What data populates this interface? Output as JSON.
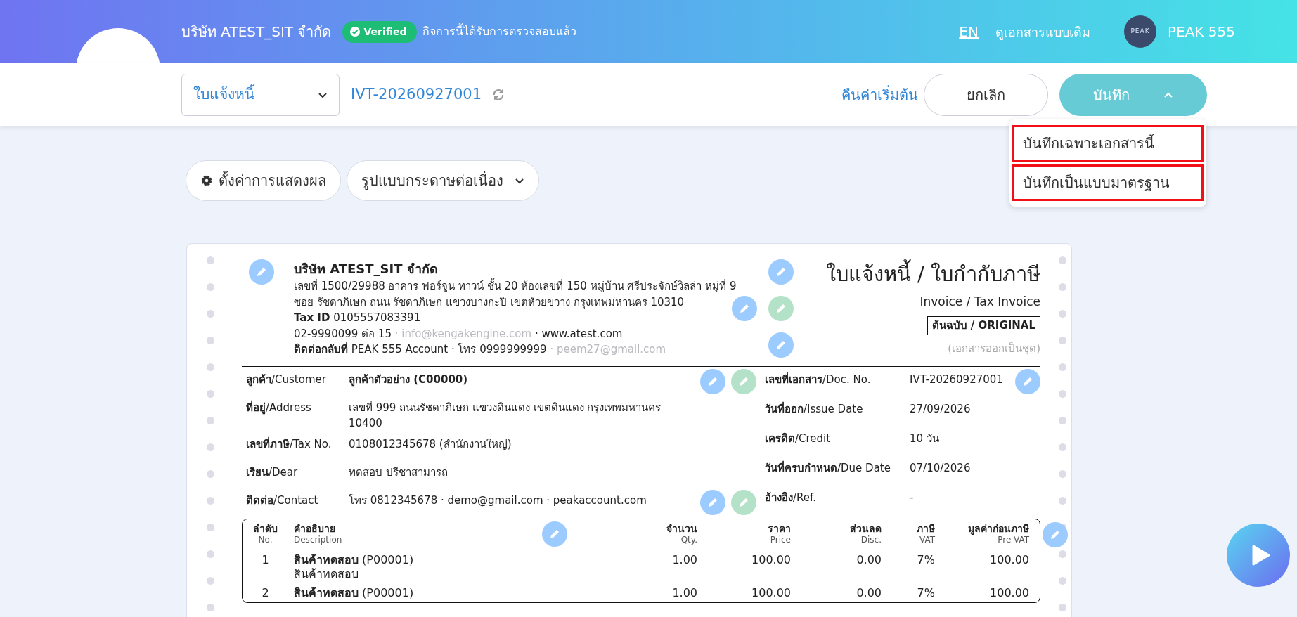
{
  "header": {
    "company": "บริษัท ATEST_SIT จำกัด",
    "verified_badge": "Verified",
    "verified_text": "กิจการนี้ได้รับการตรวจสอบแล้ว",
    "language": "EN",
    "old_view_link": "ดูเอกสารแบบเดิม",
    "user_logo_text": "PEAK",
    "user_name": "PEAK 555"
  },
  "toolbar": {
    "doc_type": "ใบแจ้งหนี้",
    "doc_number": "IVT-20260927001",
    "reset_link": "คืนค่าเริ่มต้น",
    "cancel_button": "ยกเลิก",
    "save_button": "บันทึก",
    "save_menu_expanded": true,
    "save_menu": [
      {
        "label": "บันทึกเฉพาะเอกสารนี้",
        "highlighted": true
      },
      {
        "label": "บันทึกเป็นแบบมาตรฐาน",
        "highlighted": true
      }
    ]
  },
  "display_controls": {
    "settings_button": "ตั้งค่าการแสดงผล",
    "paper_format": "รูปแบบกระดาษต่อเนื่อง"
  },
  "document": {
    "seller": {
      "name": "บริษัท ATEST_SIT จำกัด",
      "address_lines": [
        "เลขที่ 1500/29988 อาคาร ฟอร์จูน ทาวน์ ชั้น 20 ห้องเลขที่ 150 หมู่บ้าน ศรีประจักษ์วิลล่า หมู่ที่ 9",
        "ซอย รัชดาภิเษก ถนน รัชดาภิเษก แขวงบางกะปิ เขตห้วยขวาง กรุงเทพมหานคร 10310"
      ],
      "tax_id_label": "Tax ID",
      "tax_id": "0105557083391",
      "phone": "02-9990099 ต่อ 15",
      "email": "· info@kengakengine.com",
      "website": "· www.atest.com",
      "contact_label": "ติดต่อกลับที่",
      "contact": "PEAK 555 Account · โทร 0999999999",
      "contact_email": "· peem27@gmail.com"
    },
    "title": "ใบแจ้งหนี้ / ใบกำกับภาษี",
    "subtitle": "Invoice / Tax Invoice",
    "copy_label": "ต้นฉบับ / ORIGINAL",
    "set_note": "(เอกสารออกเป็นชุด)",
    "customer_fields": [
      {
        "label_th": "ลูกค้า",
        "label_en": "/Customer",
        "value": "ลูกค้าตัวอย่าง (C00000)",
        "bold": true
      },
      {
        "label_th": "ที่อยู่",
        "label_en": "/Address",
        "value": "เลขที่ 999 ถนนรัชดาภิเษก แขวงดินแดง เขตดินแดง กรุงเทพมหานคร 10400",
        "bold": false
      },
      {
        "label_th": "เลขที่ภาษี",
        "label_en": "/Tax No.",
        "value": "0108012345678 (สำนักงานใหญ่)",
        "bold": false
      },
      {
        "label_th": "เรียน",
        "label_en": "/Dear",
        "value": "ทดสอบ ปรีชาสามารถ",
        "bold": false
      },
      {
        "label_th": "ติดต่อ",
        "label_en": "/Contact",
        "value": "โทร 0812345678 · demo@gmail.com · peakaccount.com",
        "bold": false
      }
    ],
    "doc_fields": [
      {
        "label_th": "เลขที่เอกสาร",
        "label_en": "/Doc. No.",
        "value": "IVT-20260927001"
      },
      {
        "label_th": "วันที่ออก",
        "label_en": "/Issue Date",
        "value": "27/09/2026"
      },
      {
        "label_th": "เครดิต",
        "label_en": "/Credit",
        "value": "10 วัน"
      },
      {
        "label_th": "วันที่ครบกำหนด",
        "label_en": "/Due Date",
        "value": "07/10/2026"
      },
      {
        "label_th": "อ้างอิง",
        "label_en": "/Ref.",
        "value": "-"
      }
    ],
    "table": {
      "columns": [
        {
          "th": "ลำดับ",
          "en": "No."
        },
        {
          "th": "คำอธิบาย",
          "en": "Description"
        },
        {
          "th": "จำนวน",
          "en": "Qty."
        },
        {
          "th": "ราคา",
          "en": "Price"
        },
        {
          "th": "ส่วนลด",
          "en": "Disc."
        },
        {
          "th": "ภาษี",
          "en": "VAT"
        },
        {
          "th": "มูลค่าก่อนภาษี",
          "en": "Pre-VAT"
        }
      ],
      "rows": [
        {
          "no": "1",
          "name": "สินค้าทดสอบ",
          "code": "(P00001)",
          "description": "สินค้าทดสอบ",
          "qty": "1.00",
          "price": "100.00",
          "disc": "0.00",
          "vat": "7%",
          "pre_vat": "100.00"
        },
        {
          "no": "2",
          "name": "สินค้าทดสอบ",
          "code": "(P00001)",
          "qty": "1.00",
          "price": "100.00",
          "disc": "0.00",
          "vat": "7%",
          "pre_vat": "100.00"
        }
      ]
    }
  }
}
